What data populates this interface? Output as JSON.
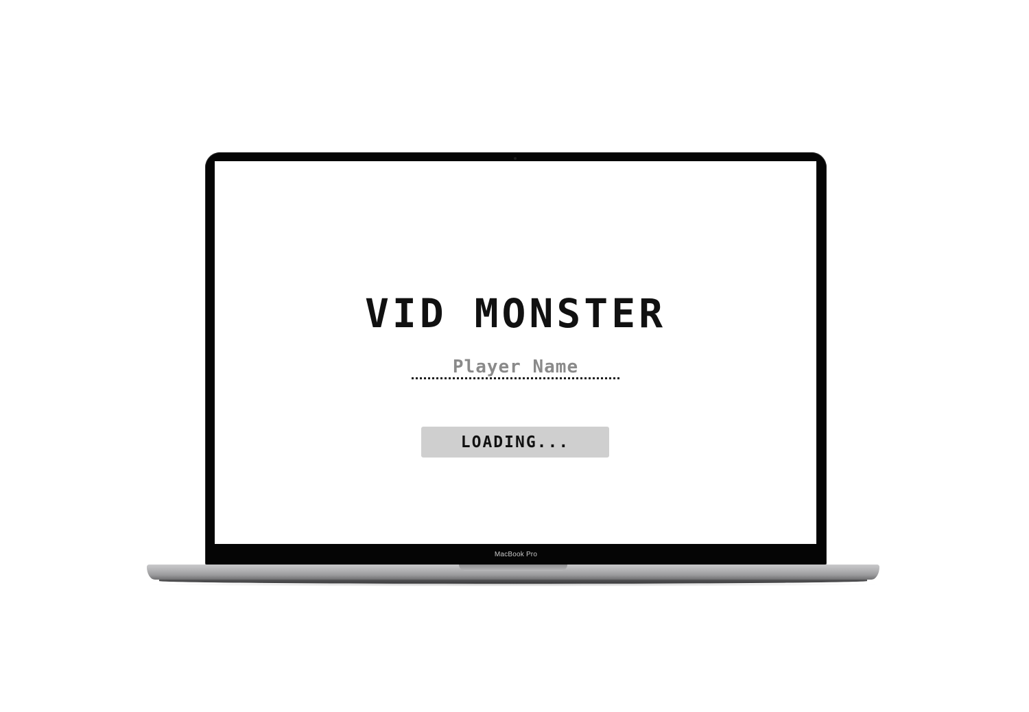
{
  "device": {
    "model_label": "MacBook Pro"
  },
  "game": {
    "title": "VID MONSTER",
    "player_name_input": {
      "value": "",
      "placeholder": "Player Name"
    },
    "status_button_label": "LOADING..."
  },
  "colors": {
    "screen_background": "#ffffff",
    "title_text": "#111111",
    "button_background": "#cfcfcf",
    "placeholder_text": "#8a8a8a",
    "bezel": "#050505"
  }
}
